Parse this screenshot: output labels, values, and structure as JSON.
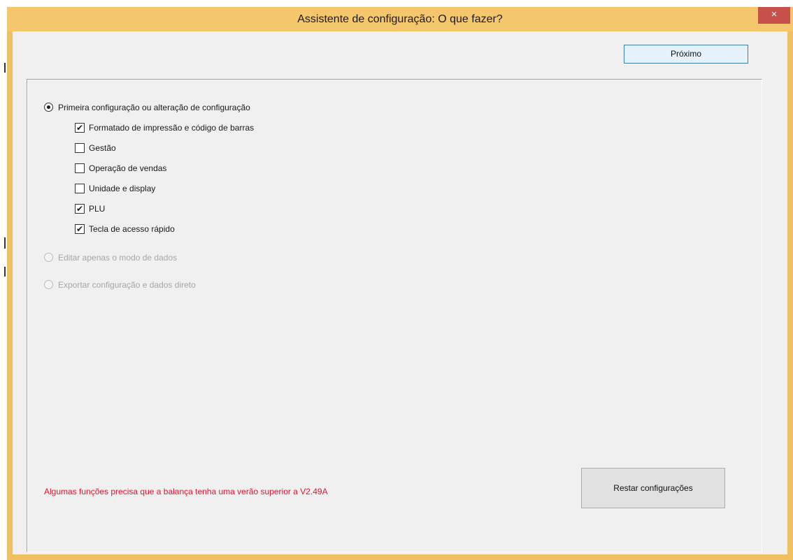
{
  "window": {
    "title": "Assistente de configuração: O que fazer?",
    "close_glyph": "×",
    "accent_title_color": "#f5c76d",
    "close_color": "#c7504a"
  },
  "toolbar": {
    "next_label": "Próximo"
  },
  "options": {
    "primary": {
      "label": "Primeira configuração ou alteração de configuração",
      "selected": true,
      "sub_items": [
        {
          "label": "Formatado de impressão e código de barras",
          "checked": true
        },
        {
          "label": "Gestão",
          "checked": false
        },
        {
          "label": "Operação de vendas",
          "checked": false
        },
        {
          "label": "Unidade e display",
          "checked": false
        },
        {
          "label": "PLU",
          "checked": true
        },
        {
          "label": "Tecla de acesso rápido",
          "checked": true
        }
      ]
    },
    "edit_data": {
      "label": "Editar apenas o modo de dados",
      "selected": false,
      "enabled": false
    },
    "export": {
      "label": "Exportar configuração e dados direto",
      "selected": false,
      "enabled": false
    }
  },
  "footer": {
    "warning": "Algumas funções precisa que a balança tenha uma verão superior a V2.49A",
    "warning_color": "#e8112d",
    "reset_label": "Restar configurações"
  },
  "check_glyph": "✔"
}
